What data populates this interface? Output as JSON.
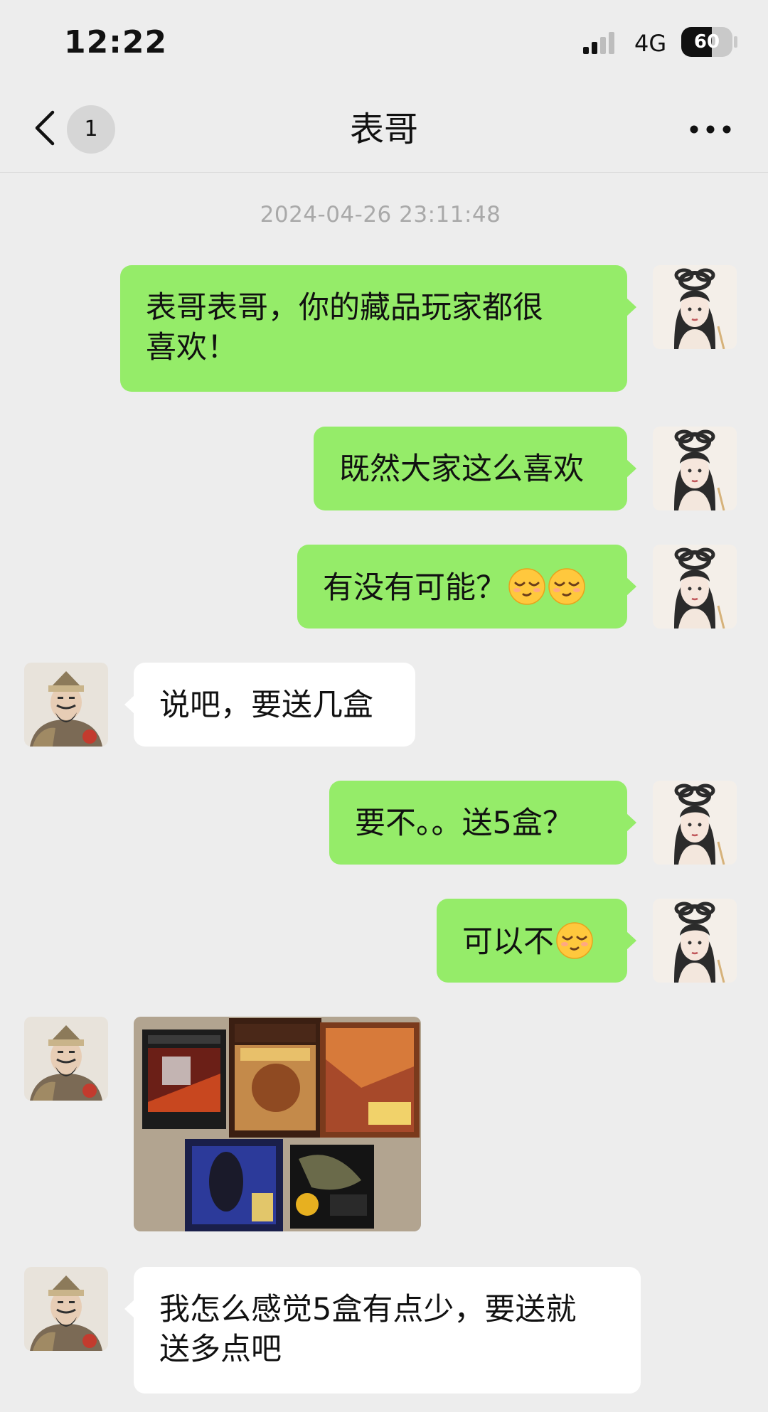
{
  "status_bar": {
    "time": "12:22",
    "network": "4G",
    "battery_level": "60",
    "battery_fraction": 0.6
  },
  "header": {
    "unread_count": "1",
    "title": "表哥",
    "back_icon": "chevron-left-icon",
    "more_icon": "more-horizontal-icon"
  },
  "timestamp": "2024-04-26 23:11:48",
  "colors": {
    "outgoing_bubble": "#95ec69",
    "incoming_bubble": "#ffffff",
    "background": "#ededed"
  },
  "messages": [
    {
      "from": "me",
      "text": "表哥表哥，你的藏品玩家都很",
      "text_line2": "喜欢！"
    },
    {
      "from": "me",
      "text": "既然大家这么喜欢"
    },
    {
      "from": "me",
      "text": "有没有可能？",
      "emoji_count": 2,
      "emoji": "smirk-emoji"
    },
    {
      "from": "cousin",
      "text": "说吧，要送几盒"
    },
    {
      "from": "me",
      "text": "要不。。送5盒？"
    },
    {
      "from": "me",
      "text": "可以不",
      "emoji_count": 1,
      "emoji": "smirk-emoji"
    },
    {
      "from": "cousin",
      "type": "image",
      "content": "game-boxes-photo"
    },
    {
      "from": "cousin",
      "text": "我怎么感觉5盒有点少，要送就",
      "text_line2": "送多点吧"
    }
  ]
}
